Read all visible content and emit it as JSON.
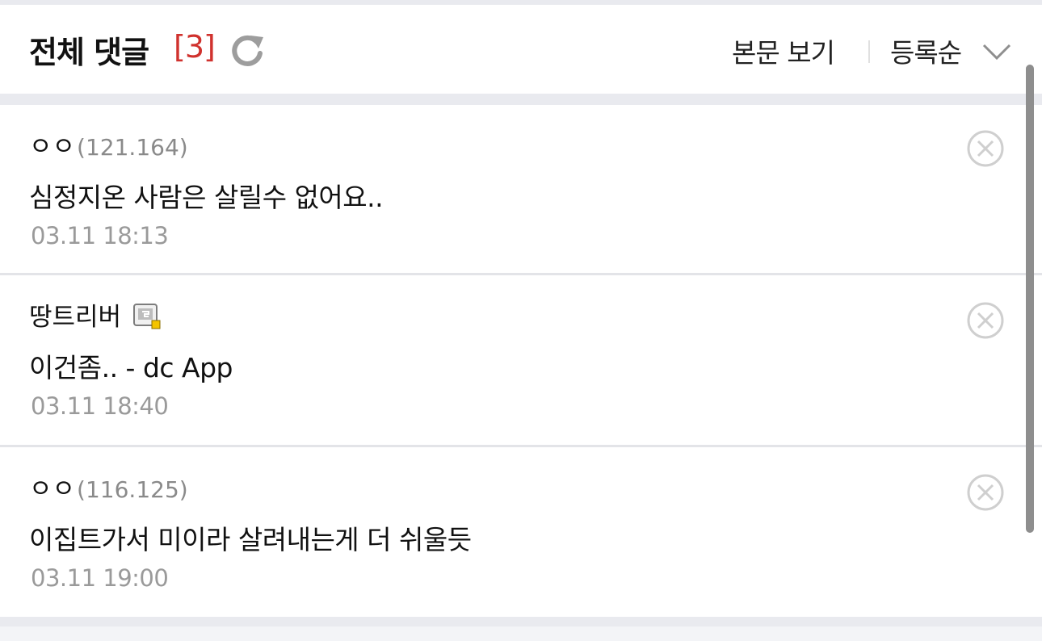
{
  "header": {
    "title": "전체 댓글",
    "count": "[3]",
    "view_body_label": "본문 보기",
    "sort_label": "등록순"
  },
  "comments": [
    {
      "nick": "ㅇㅇ",
      "ip": "(121.164)",
      "text": "심정지온 사람은 살릴수 없어요..",
      "date": "03.11 18:13"
    },
    {
      "nick": "땅트리버",
      "ip": "",
      "text": "이건좀.. - dc App",
      "date": "03.11 18:40"
    },
    {
      "nick": "ㅇㅇ",
      "ip": "(116.125)",
      "text": "이집트가서 미이라 살려내는게 더 쉬울듯",
      "date": "03.11 19:00"
    }
  ],
  "colors": {
    "accent_count": "#d0322e",
    "background": "#e9eaef",
    "meta_text": "#9a9a9a"
  },
  "icons": {
    "refresh": "refresh-icon",
    "sort": "chevron-down-icon",
    "delete": "delete-circle-x-icon",
    "gallog": "gallog-user-icon"
  }
}
